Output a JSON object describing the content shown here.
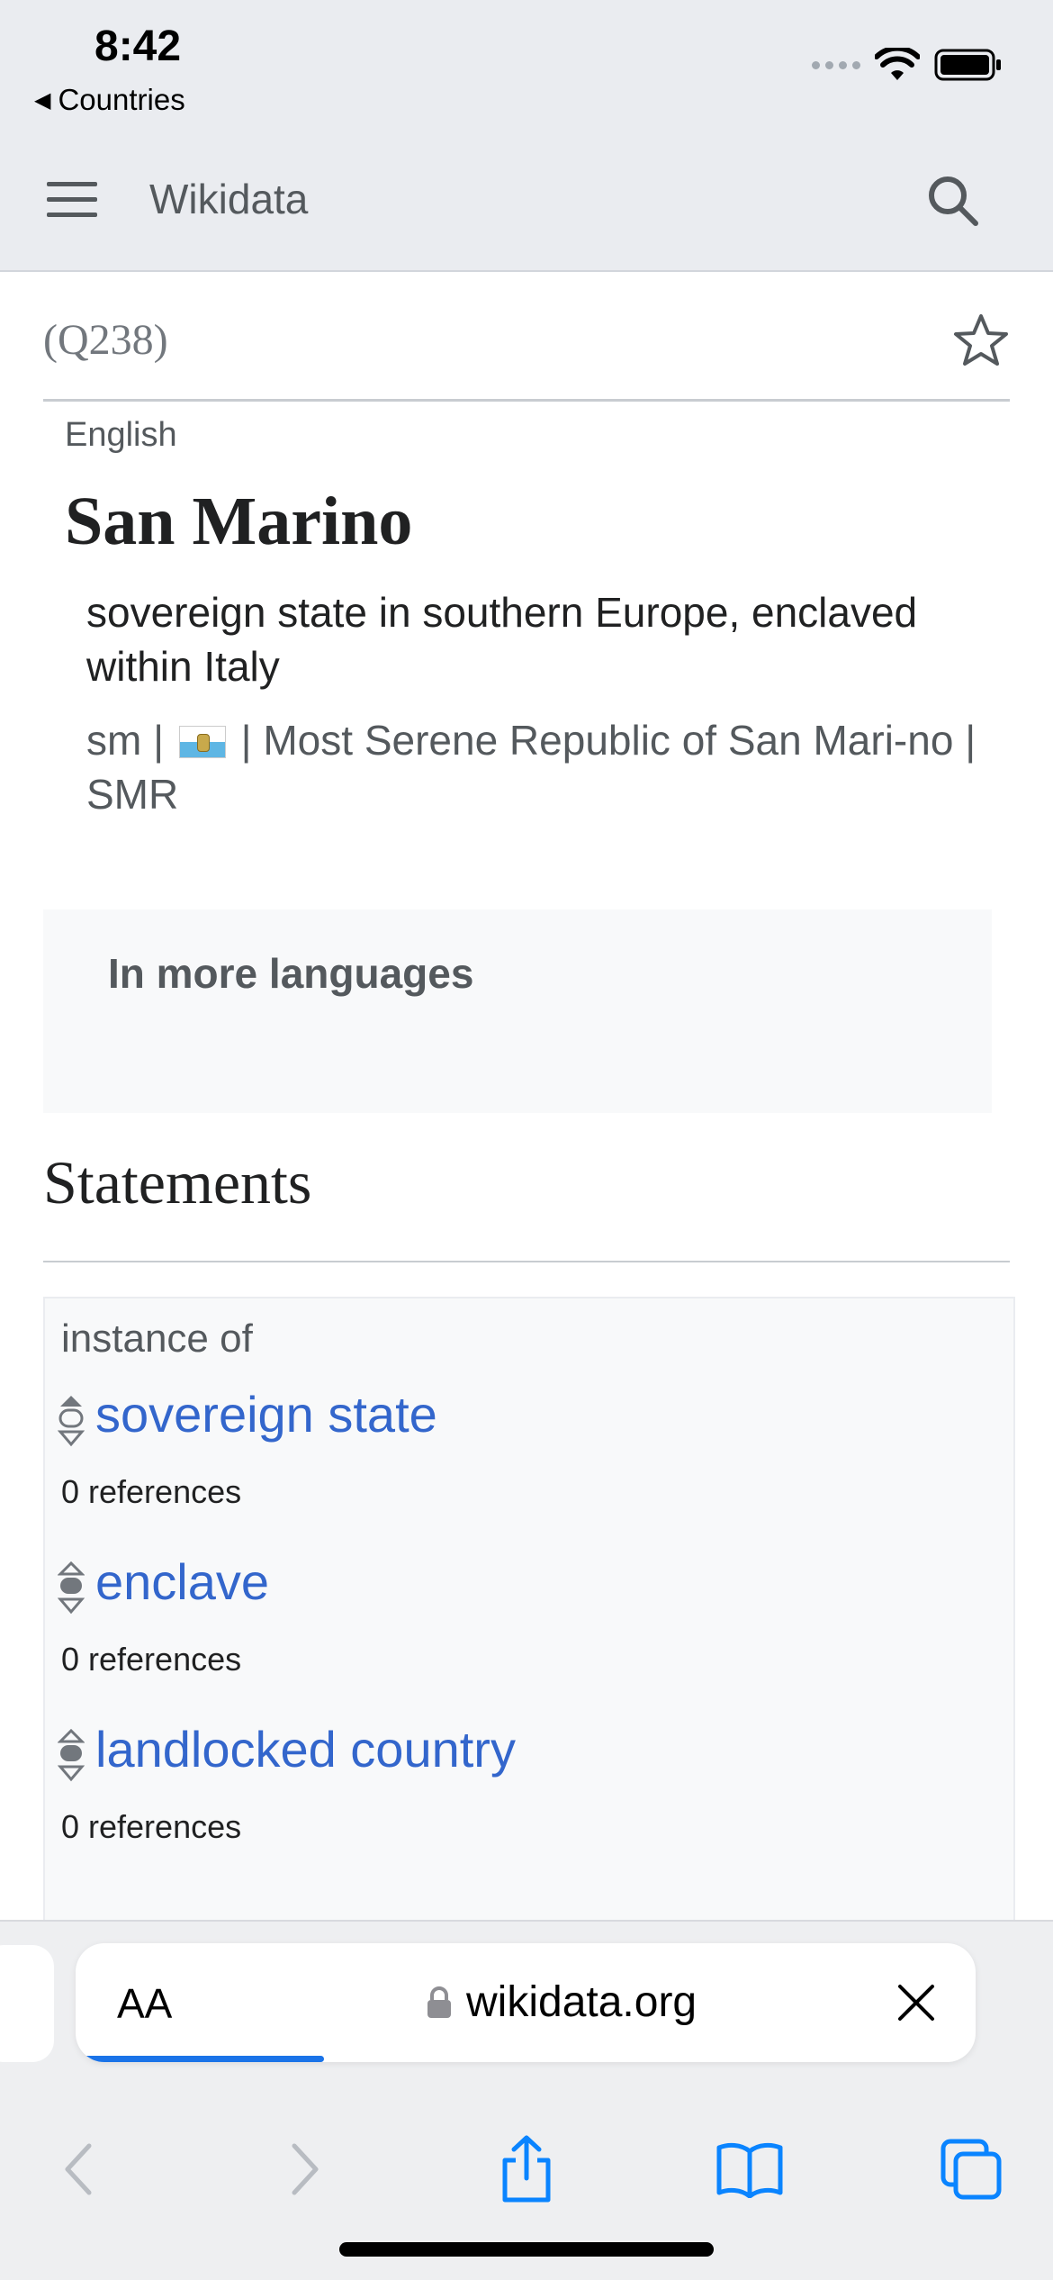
{
  "status_bar": {
    "time": "8:42",
    "back_label": "Countries"
  },
  "header": {
    "site_name": "Wikidata"
  },
  "item": {
    "qid": "(Q238)",
    "language": "English",
    "label": "San Marino",
    "description": "sovereign state in southern Europe, enclaved within Italy",
    "aliases": {
      "first": "sm",
      "separator": "|",
      "third": "Most Serene Republic of San Mari-no",
      "fourth": "SMR"
    }
  },
  "more_languages": {
    "title": "In more languages"
  },
  "statements": {
    "title": "Statements",
    "property_label": "instance of",
    "claims": [
      {
        "value": "sovereign state",
        "refs": "0 references"
      },
      {
        "value": "enclave",
        "refs": "0 references"
      },
      {
        "value": "landlocked country",
        "refs": "0 references"
      }
    ]
  },
  "browser": {
    "aa_label": "AA",
    "url": "wikidata.org",
    "accent": "#1a73e8"
  },
  "colors": {
    "link": "#3366cc",
    "header_bg": "#eaecf0",
    "ios_blue": "#0a84ff"
  }
}
